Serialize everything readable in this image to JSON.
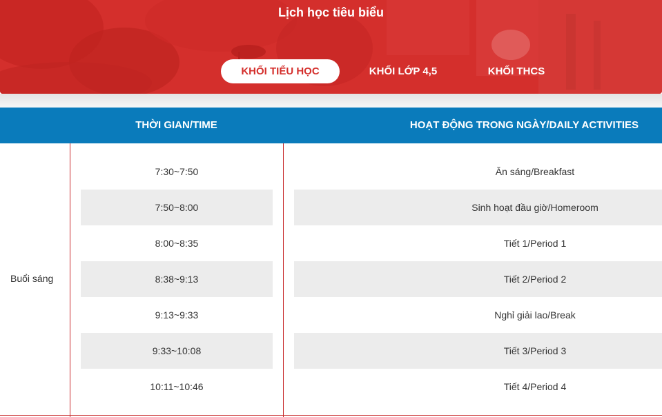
{
  "hero": {
    "title": "Lịch học tiêu biểu",
    "background_color": "#d42f2c"
  },
  "tabs": [
    {
      "label": "KHỐI TIỂU HỌC",
      "active": true
    },
    {
      "label": "KHỐI LỚP 4,5",
      "active": false
    },
    {
      "label": "KHỐI THCS",
      "active": false
    }
  ],
  "table": {
    "header_color": "#0a7bbb",
    "headers": {
      "time": "THỜI GIAN/TIME",
      "activity": "HOẠT ĐỘNG TRONG NGÀY/DAILY ACTIVITIES"
    },
    "session_label": "Buổi sáng",
    "rows": [
      {
        "time": "7:30~7:50",
        "activity": "Ăn sáng/Breakfast"
      },
      {
        "time": "7:50~8:00",
        "activity": "Sinh hoạt đầu giờ/Homeroom"
      },
      {
        "time": "8:00~8:35",
        "activity": "Tiết 1/Period 1"
      },
      {
        "time": "8:38~9:13",
        "activity": "Tiết 2/Period 2"
      },
      {
        "time": "9:13~9:33",
        "activity": "Nghỉ giải lao/Break"
      },
      {
        "time": "9:33~10:08",
        "activity": "Tiết 3/Period 3"
      },
      {
        "time": "10:11~10:46",
        "activity": "Tiết 4/Period 4"
      }
    ]
  }
}
